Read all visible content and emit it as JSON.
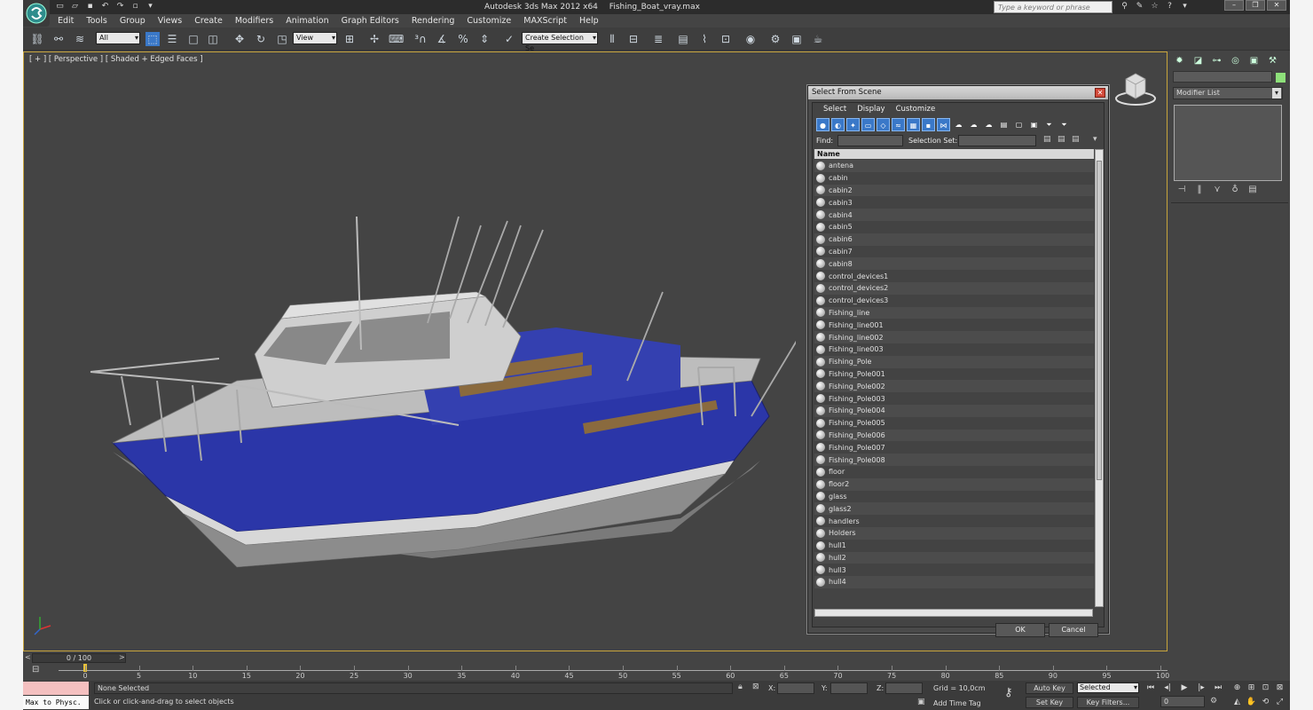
{
  "app": {
    "title": "Autodesk 3ds Max  2012 x64",
    "file": "Fishing_Boat_vray.max",
    "search_placeholder": "Type a keyword or phrase"
  },
  "menu": [
    "Edit",
    "Tools",
    "Group",
    "Views",
    "Create",
    "Modifiers",
    "Animation",
    "Graph Editors",
    "Rendering",
    "Customize",
    "MAXScript",
    "Help"
  ],
  "toolbar": {
    "filter": "All",
    "coord_system": "View",
    "named_selection": "Create Selection Se"
  },
  "viewport": {
    "label": "[ + ] [ Perspective ] [ Shaded + Edged Faces ]",
    "colors": {
      "hull_blue": "#2b36a8",
      "hull_grey": "#9a9a9a",
      "deck": "#c9c9c9",
      "bench_wood": "#8a6a3e",
      "active_border": "#c8a43c"
    }
  },
  "command_panel": {
    "modifier_list": "Modifier List",
    "color_swatch": "#8ee07a"
  },
  "dialog": {
    "title": "Select From Scene",
    "menu": [
      "Select",
      "Display",
      "Customize"
    ],
    "find_label": "Find:",
    "selection_set_label": "Selection Set:",
    "column_header": "Name",
    "objects": [
      "antena",
      "cabin",
      "cabin2",
      "cabin3",
      "cabin4",
      "cabin5",
      "cabin6",
      "cabin7",
      "cabin8",
      "control_devices1",
      "control_devices2",
      "control_devices3",
      "Fishing_line",
      "Fishing_line001",
      "Fishing_line002",
      "Fishing_line003",
      "Fishing_Pole",
      "Fishing_Pole001",
      "Fishing_Pole002",
      "Fishing_Pole003",
      "Fishing_Pole004",
      "Fishing_Pole005",
      "Fishing_Pole006",
      "Fishing_Pole007",
      "Fishing_Pole008",
      "floor",
      "floor2",
      "glass",
      "glass2",
      "handlers",
      "Holders",
      "hull1",
      "hull2",
      "hull3",
      "hull4"
    ],
    "ok": "OK",
    "cancel": "Cancel"
  },
  "timeline": {
    "slider": "0 / 100",
    "ticks": [
      "0",
      "5",
      "10",
      "15",
      "20",
      "25",
      "30",
      "35",
      "40",
      "45",
      "50",
      "55",
      "60",
      "65",
      "70",
      "75",
      "80",
      "85",
      "90",
      "95",
      "100"
    ]
  },
  "status": {
    "maxscript": "Max to Physc.",
    "selection": "None Selected",
    "prompt": "Click or click-and-drag to select objects",
    "x_label": "X:",
    "y_label": "Y:",
    "z_label": "Z:",
    "grid": "Grid = 10,0cm",
    "add_time_tag": "Add Time Tag",
    "auto_key": "Auto Key",
    "set_key": "Set Key",
    "selected_mode": "Selected",
    "key_filters": "Key Filters...",
    "frame": "0"
  }
}
